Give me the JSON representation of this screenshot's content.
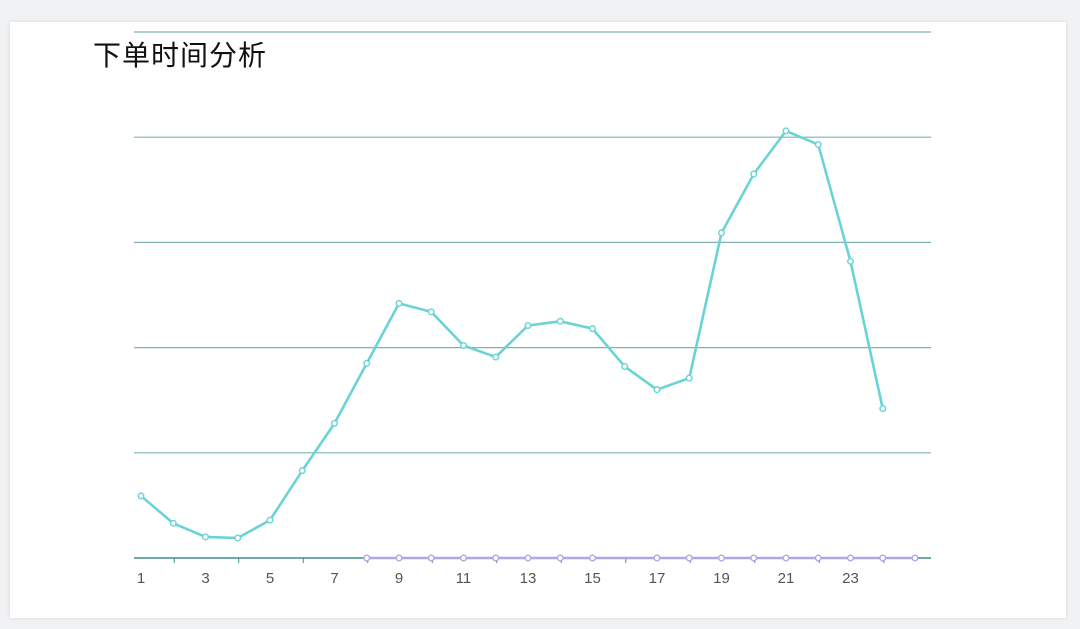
{
  "chart_data": {
    "type": "line",
    "title": "下单时间分析",
    "xlabel": "",
    "ylabel": "",
    "x": [
      1,
      2,
      3,
      4,
      5,
      6,
      7,
      8,
      9,
      10,
      11,
      12,
      13,
      14,
      15,
      16,
      17,
      18,
      19,
      20,
      21,
      22,
      23,
      24
    ],
    "x_tick_labels": [
      "1",
      "3",
      "5",
      "7",
      "9",
      "11",
      "13",
      "15",
      "17",
      "19",
      "21",
      "23"
    ],
    "x_tick_values": [
      1,
      3,
      5,
      7,
      9,
      11,
      13,
      15,
      17,
      19,
      21,
      23
    ],
    "ylim": [
      0,
      5
    ],
    "grid": true,
    "series": [
      {
        "values": [
          0.59,
          0.33,
          0.2,
          0.19,
          0.36,
          0.83,
          1.28,
          1.85,
          2.42,
          2.34,
          2.02,
          1.91,
          2.21,
          2.25,
          2.18,
          1.82,
          1.6,
          1.71,
          3.09,
          3.65,
          4.06,
          3.93,
          2.82,
          1.42
        ],
        "color": "#6ad3d6"
      },
      {
        "x": [
          8,
          9,
          10,
          11,
          12,
          13,
          14,
          15,
          17,
          18,
          19,
          20,
          21,
          22,
          23,
          24,
          25
        ],
        "values": [
          0,
          0,
          0,
          0,
          0,
          0,
          0,
          0,
          0,
          0,
          0,
          0,
          0,
          0,
          0,
          0,
          0
        ],
        "color": "#b4a6e4"
      }
    ],
    "gridline_color": "#7fb2b4",
    "axis_color": "#3d8f87"
  }
}
